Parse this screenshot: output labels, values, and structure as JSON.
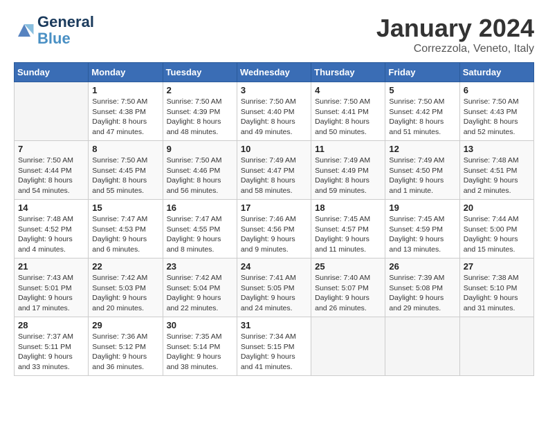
{
  "logo": {
    "line1": "General",
    "line2": "Blue"
  },
  "title": "January 2024",
  "location": "Correzzola, Veneto, Italy",
  "headers": [
    "Sunday",
    "Monday",
    "Tuesday",
    "Wednesday",
    "Thursday",
    "Friday",
    "Saturday"
  ],
  "weeks": [
    [
      {
        "day": "",
        "info": ""
      },
      {
        "day": "1",
        "info": "Sunrise: 7:50 AM\nSunset: 4:38 PM\nDaylight: 8 hours\nand 47 minutes."
      },
      {
        "day": "2",
        "info": "Sunrise: 7:50 AM\nSunset: 4:39 PM\nDaylight: 8 hours\nand 48 minutes."
      },
      {
        "day": "3",
        "info": "Sunrise: 7:50 AM\nSunset: 4:40 PM\nDaylight: 8 hours\nand 49 minutes."
      },
      {
        "day": "4",
        "info": "Sunrise: 7:50 AM\nSunset: 4:41 PM\nDaylight: 8 hours\nand 50 minutes."
      },
      {
        "day": "5",
        "info": "Sunrise: 7:50 AM\nSunset: 4:42 PM\nDaylight: 8 hours\nand 51 minutes."
      },
      {
        "day": "6",
        "info": "Sunrise: 7:50 AM\nSunset: 4:43 PM\nDaylight: 8 hours\nand 52 minutes."
      }
    ],
    [
      {
        "day": "7",
        "info": "Sunrise: 7:50 AM\nSunset: 4:44 PM\nDaylight: 8 hours\nand 54 minutes."
      },
      {
        "day": "8",
        "info": "Sunrise: 7:50 AM\nSunset: 4:45 PM\nDaylight: 8 hours\nand 55 minutes."
      },
      {
        "day": "9",
        "info": "Sunrise: 7:50 AM\nSunset: 4:46 PM\nDaylight: 8 hours\nand 56 minutes."
      },
      {
        "day": "10",
        "info": "Sunrise: 7:49 AM\nSunset: 4:47 PM\nDaylight: 8 hours\nand 58 minutes."
      },
      {
        "day": "11",
        "info": "Sunrise: 7:49 AM\nSunset: 4:49 PM\nDaylight: 8 hours\nand 59 minutes."
      },
      {
        "day": "12",
        "info": "Sunrise: 7:49 AM\nSunset: 4:50 PM\nDaylight: 9 hours\nand 1 minute."
      },
      {
        "day": "13",
        "info": "Sunrise: 7:48 AM\nSunset: 4:51 PM\nDaylight: 9 hours\nand 2 minutes."
      }
    ],
    [
      {
        "day": "14",
        "info": "Sunrise: 7:48 AM\nSunset: 4:52 PM\nDaylight: 9 hours\nand 4 minutes."
      },
      {
        "day": "15",
        "info": "Sunrise: 7:47 AM\nSunset: 4:53 PM\nDaylight: 9 hours\nand 6 minutes."
      },
      {
        "day": "16",
        "info": "Sunrise: 7:47 AM\nSunset: 4:55 PM\nDaylight: 9 hours\nand 8 minutes."
      },
      {
        "day": "17",
        "info": "Sunrise: 7:46 AM\nSunset: 4:56 PM\nDaylight: 9 hours\nand 9 minutes."
      },
      {
        "day": "18",
        "info": "Sunrise: 7:45 AM\nSunset: 4:57 PM\nDaylight: 9 hours\nand 11 minutes."
      },
      {
        "day": "19",
        "info": "Sunrise: 7:45 AM\nSunset: 4:59 PM\nDaylight: 9 hours\nand 13 minutes."
      },
      {
        "day": "20",
        "info": "Sunrise: 7:44 AM\nSunset: 5:00 PM\nDaylight: 9 hours\nand 15 minutes."
      }
    ],
    [
      {
        "day": "21",
        "info": "Sunrise: 7:43 AM\nSunset: 5:01 PM\nDaylight: 9 hours\nand 17 minutes."
      },
      {
        "day": "22",
        "info": "Sunrise: 7:42 AM\nSunset: 5:03 PM\nDaylight: 9 hours\nand 20 minutes."
      },
      {
        "day": "23",
        "info": "Sunrise: 7:42 AM\nSunset: 5:04 PM\nDaylight: 9 hours\nand 22 minutes."
      },
      {
        "day": "24",
        "info": "Sunrise: 7:41 AM\nSunset: 5:05 PM\nDaylight: 9 hours\nand 24 minutes."
      },
      {
        "day": "25",
        "info": "Sunrise: 7:40 AM\nSunset: 5:07 PM\nDaylight: 9 hours\nand 26 minutes."
      },
      {
        "day": "26",
        "info": "Sunrise: 7:39 AM\nSunset: 5:08 PM\nDaylight: 9 hours\nand 29 minutes."
      },
      {
        "day": "27",
        "info": "Sunrise: 7:38 AM\nSunset: 5:10 PM\nDaylight: 9 hours\nand 31 minutes."
      }
    ],
    [
      {
        "day": "28",
        "info": "Sunrise: 7:37 AM\nSunset: 5:11 PM\nDaylight: 9 hours\nand 33 minutes."
      },
      {
        "day": "29",
        "info": "Sunrise: 7:36 AM\nSunset: 5:12 PM\nDaylight: 9 hours\nand 36 minutes."
      },
      {
        "day": "30",
        "info": "Sunrise: 7:35 AM\nSunset: 5:14 PM\nDaylight: 9 hours\nand 38 minutes."
      },
      {
        "day": "31",
        "info": "Sunrise: 7:34 AM\nSunset: 5:15 PM\nDaylight: 9 hours\nand 41 minutes."
      },
      {
        "day": "",
        "info": ""
      },
      {
        "day": "",
        "info": ""
      },
      {
        "day": "",
        "info": ""
      }
    ]
  ]
}
